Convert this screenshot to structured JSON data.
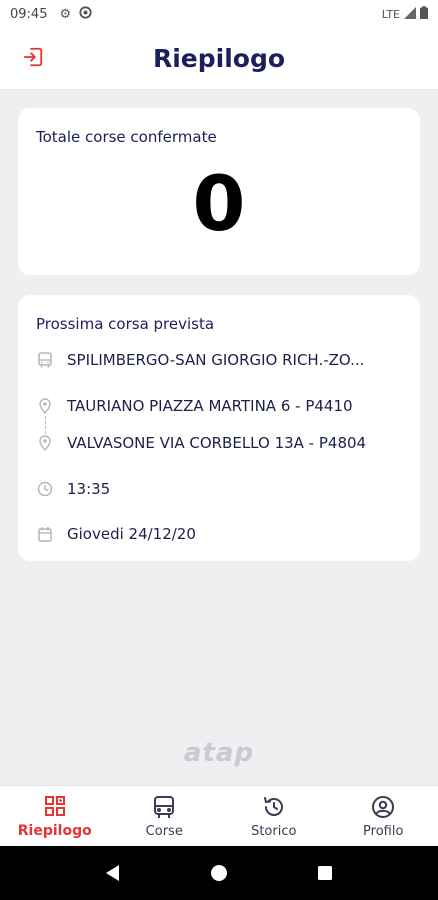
{
  "status_bar": {
    "time": "09:45",
    "network": "LTE",
    "icons": [
      "settings-icon",
      "sync-icon",
      "signal-icon",
      "battery-icon"
    ]
  },
  "header": {
    "title": "Riepilogo",
    "logout_icon": "logout-icon",
    "accent_color": "#e63333"
  },
  "summary": {
    "label": "Totale corse confermate",
    "count": "0"
  },
  "next_trip": {
    "label": "Prossima corsa prevista",
    "line": "SPILIMBERGO-SAN GIORGIO RICH.-ZO...",
    "from": "TAURIANO PIAZZA MARTINA 6 - P4410",
    "to": "VALVASONE VIA CORBELLO 13A - P4804",
    "time": "13:35",
    "date": "Giovedi 24/12/20"
  },
  "brand": {
    "logo_text": "atap"
  },
  "bottom_nav": {
    "items": [
      {
        "label": "Riepilogo",
        "icon": "dashboard-icon",
        "active": true
      },
      {
        "label": "Corse",
        "icon": "bus-icon",
        "active": false
      },
      {
        "label": "Storico",
        "icon": "history-icon",
        "active": false
      },
      {
        "label": "Profilo",
        "icon": "profile-icon",
        "active": false
      }
    ]
  }
}
